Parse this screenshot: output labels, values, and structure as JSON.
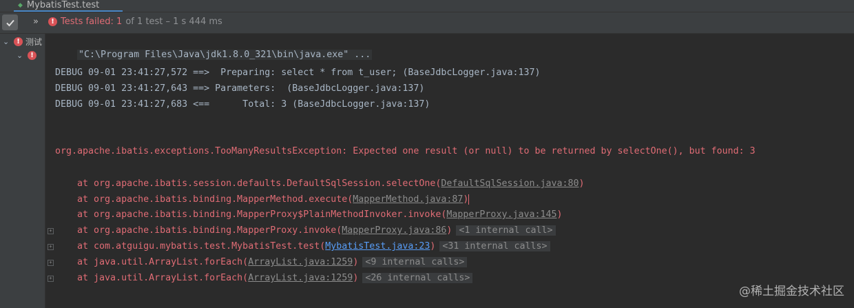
{
  "tab": {
    "title": "MybatisTest.test"
  },
  "toolbar": {
    "status_failed": "Tests failed: 1",
    "status_rest": "of 1 test – 1 s 444 ms",
    "chevron": "»"
  },
  "tree": {
    "root_label": "测试",
    "err_symbol": "!"
  },
  "console": {
    "cmd": "\"C:\\Program Files\\Java\\jdk1.8.0_321\\bin\\java.exe\" ...",
    "debug_lines": [
      "DEBUG 09-01 23:41:27,572 ==>  Preparing: select * from t_user; (BaseJdbcLogger.java:137)",
      "DEBUG 09-01 23:41:27,643 ==> Parameters:  (BaseJdbcLogger.java:137)",
      "DEBUG 09-01 23:41:27,683 <==      Total: 3 (BaseJdbcLogger.java:137)"
    ],
    "exception": "org.apache.ibatis.exceptions.TooManyResultsException: Expected one result (or null) to be returned by selectOne(), but found: 3",
    "stack": [
      {
        "prefix": "    at org.apache.ibatis.session.defaults.DefaultSqlSession.selectOne(",
        "link": "DefaultSqlSession.java:80",
        "suffix": ")",
        "internal": ""
      },
      {
        "prefix": "    at org.apache.ibatis.binding.MapperMethod.execute(",
        "link": "MapperMethod.java:87",
        "suffix": ")",
        "internal": ""
      },
      {
        "prefix": "    at org.apache.ibatis.binding.MapperProxy$PlainMethodInvoker.invoke(",
        "link": "MapperProxy.java:145",
        "suffix": ")",
        "internal": ""
      },
      {
        "prefix": "    at org.apache.ibatis.binding.MapperProxy.invoke(",
        "link": "MapperProxy.java:86",
        "suffix": ")",
        "internal": "<1 internal call>"
      },
      {
        "prefix": "    at com.atguigu.mybatis.test.MybatisTest.test(",
        "link": "MybatisTest.java:23",
        "suffix": ")",
        "internal": "<31 internal calls>"
      },
      {
        "prefix": "    at java.util.ArrayList.forEach(",
        "link": "ArrayList.java:1259",
        "suffix": ")",
        "internal": "<9 internal calls>"
      },
      {
        "prefix": "    at java.util.ArrayList.forEach(",
        "link": "ArrayList.java:1259",
        "suffix": ")",
        "internal": "<26 internal calls>"
      }
    ]
  },
  "watermark": "@稀土掘金技术社区",
  "colors": {
    "background": "#2b2b2b",
    "error": "#e06c75",
    "link": "#589df6",
    "text": "#a9b7c6"
  }
}
